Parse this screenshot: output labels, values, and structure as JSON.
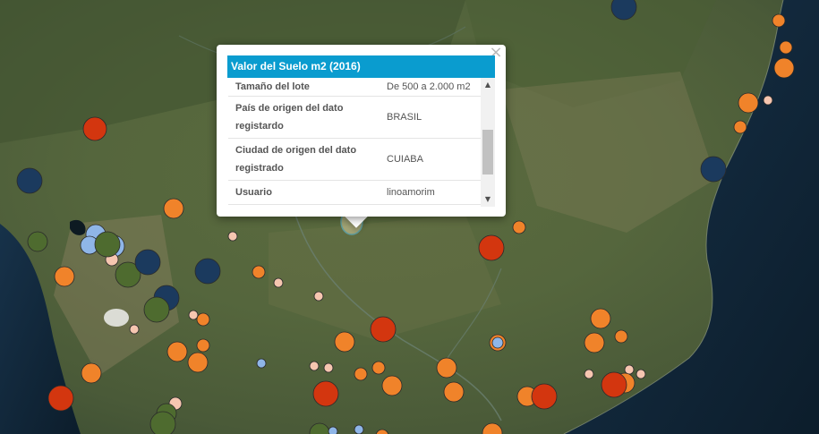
{
  "popup": {
    "title": "Valor del Suelo m2 (2016)",
    "close_symbol": "×",
    "rows": [
      {
        "key": "Tamaño del lote",
        "value": "De 500 a 2.000 m2"
      },
      {
        "key": "País de origen del dato registardo",
        "value": "BRASIL"
      },
      {
        "key": "Ciudad de origen del dato registrado",
        "value": "CUIABA"
      },
      {
        "key": "Usuario",
        "value": "linoamorim"
      }
    ],
    "scroll_up_symbol": "▲",
    "scroll_down_symbol": "▼"
  },
  "colors": {
    "orange": "#f0832a",
    "red": "#d3360f",
    "navy": "#1b3a5e",
    "olive": "#4e6b2f",
    "light_blue": "#8fb6e8",
    "pale": "#f6c6b0",
    "title_bar": "#0a9ccf"
  }
}
